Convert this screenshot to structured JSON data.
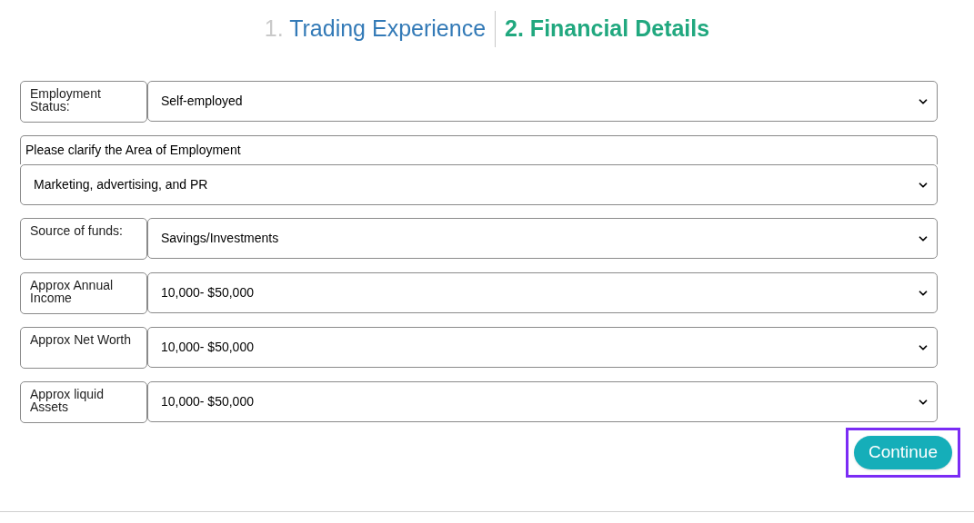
{
  "steps": [
    {
      "number": "1.",
      "label": "Trading Experience",
      "selected": false
    },
    {
      "number": "2.",
      "label": "Financial Details",
      "selected": true
    }
  ],
  "fields": [
    {
      "kind": "inline",
      "label": "Employment Status:",
      "value": "Self-employed"
    },
    {
      "kind": "stacked",
      "label": "Please clarify the Area of Employment",
      "value": "Marketing, advertising, and PR"
    },
    {
      "kind": "inline",
      "label": "Source of funds:",
      "value": "Savings/Investments"
    },
    {
      "kind": "inline",
      "label": "Approx Annual Income",
      "value": "10,000- $50,000"
    },
    {
      "kind": "inline",
      "label": "Approx Net Worth",
      "value": "10,000- $50,000"
    },
    {
      "kind": "inline",
      "label": "Approx liquid Assets",
      "value": "10,000- $50,000"
    }
  ],
  "continue_button": {
    "label": "Continue",
    "highlighted": true
  }
}
